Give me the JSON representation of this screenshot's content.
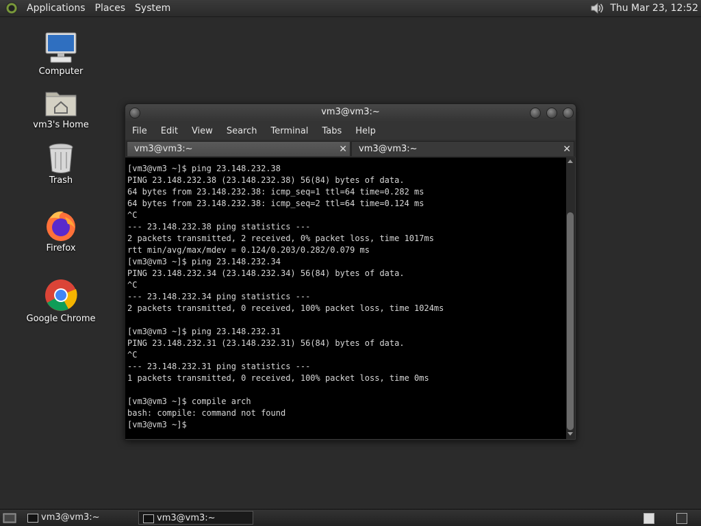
{
  "top_panel": {
    "menus": [
      "Applications",
      "Places",
      "System"
    ],
    "clock": "Thu Mar 23, 12:52"
  },
  "desktop": {
    "icons": [
      {
        "label": "Computer",
        "icon": "computer-icon"
      },
      {
        "label": "vm3's Home",
        "icon": "home-folder-icon"
      },
      {
        "label": "Trash",
        "icon": "trash-icon"
      },
      {
        "label": "Firefox",
        "icon": "firefox-icon"
      },
      {
        "label": "Google Chrome",
        "icon": "chrome-icon"
      }
    ]
  },
  "window": {
    "title": "vm3@vm3:~",
    "menu": [
      "File",
      "Edit",
      "View",
      "Search",
      "Terminal",
      "Tabs",
      "Help"
    ],
    "tabs": [
      {
        "label": "vm3@vm3:~",
        "active": false
      },
      {
        "label": "vm3@vm3:~",
        "active": true
      }
    ],
    "terminal_lines": [
      "[vm3@vm3 ~]$ ping 23.148.232.38",
      "PING 23.148.232.38 (23.148.232.38) 56(84) bytes of data.",
      "64 bytes from 23.148.232.38: icmp_seq=1 ttl=64 time=0.282 ms",
      "64 bytes from 23.148.232.38: icmp_seq=2 ttl=64 time=0.124 ms",
      "^C",
      "--- 23.148.232.38 ping statistics ---",
      "2 packets transmitted, 2 received, 0% packet loss, time 1017ms",
      "rtt min/avg/max/mdev = 0.124/0.203/0.282/0.079 ms",
      "[vm3@vm3 ~]$ ping 23.148.232.34",
      "PING 23.148.232.34 (23.148.232.34) 56(84) bytes of data.",
      "^C",
      "--- 23.148.232.34 ping statistics ---",
      "2 packets transmitted, 0 received, 100% packet loss, time 1024ms",
      "",
      "[vm3@vm3 ~]$ ping 23.148.232.31",
      "PING 23.148.232.31 (23.148.232.31) 56(84) bytes of data.",
      "^C",
      "--- 23.148.232.31 ping statistics ---",
      "1 packets transmitted, 0 received, 100% packet loss, time 0ms",
      "",
      "[vm3@vm3 ~]$ compile arch",
      "bash: compile: command not found",
      "[vm3@vm3 ~]$ "
    ]
  },
  "taskbar": {
    "tasks": [
      {
        "label": "vm3@vm3:~",
        "active": false
      },
      {
        "label": "vm3@vm3:~",
        "active": true
      }
    ]
  }
}
